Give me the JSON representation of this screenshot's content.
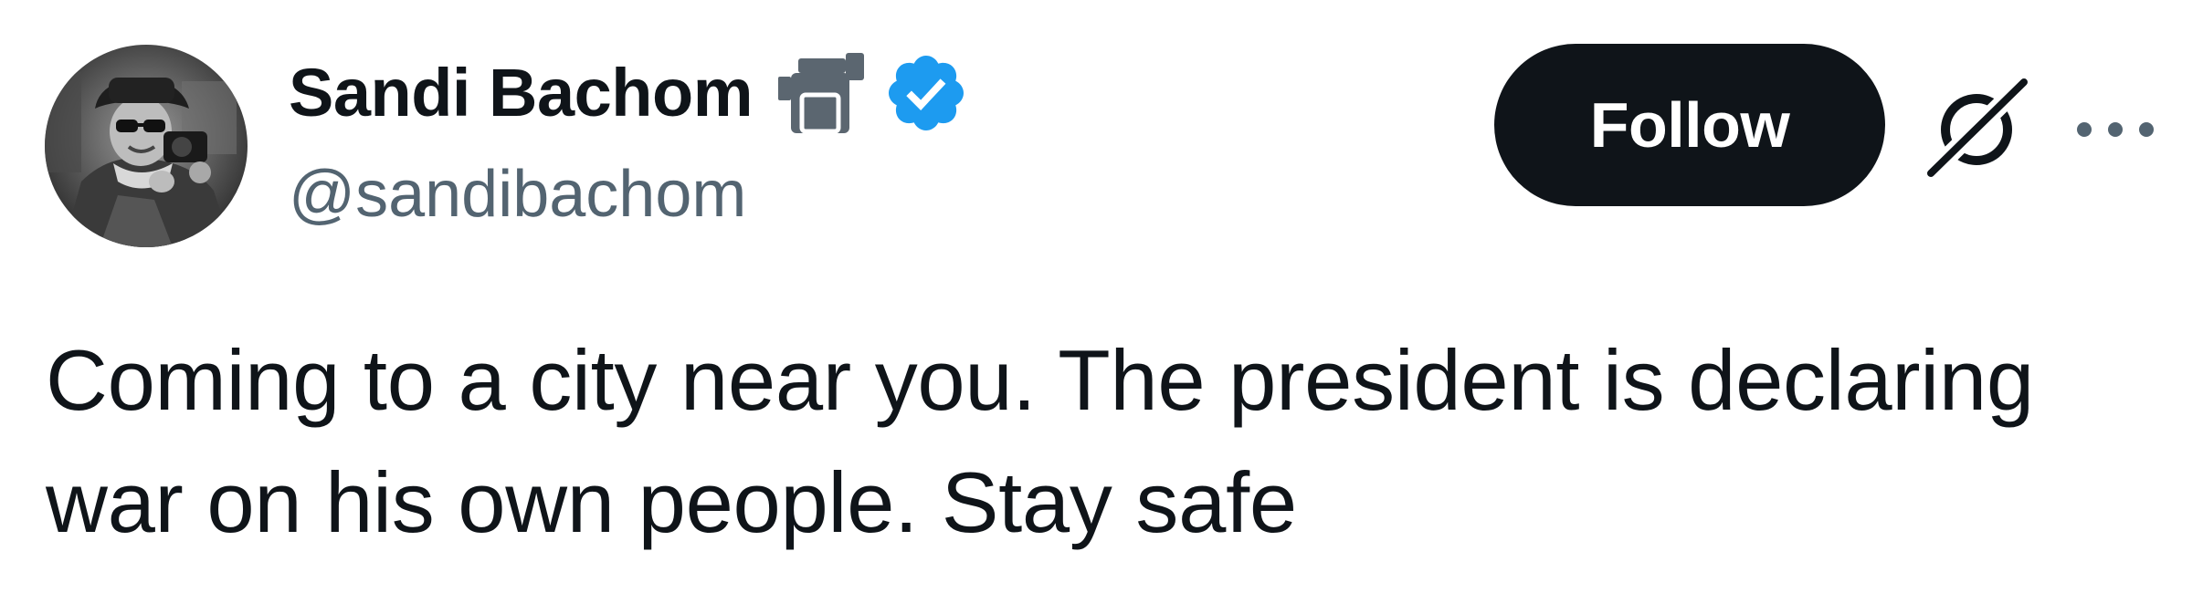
{
  "author": {
    "display_name": "Sandi Bachom",
    "handle": "@sandibachom",
    "avatar_icon": "profile-photo",
    "camera_icon": "video-camera-icon",
    "verified_icon": "verified-badge-icon",
    "verified_color": "#1d9bf0"
  },
  "actions": {
    "follow_label": "Follow",
    "grok_icon": "grok-icon",
    "more_icon": "more-options-icon"
  },
  "tweet": {
    "text": "Coming to a city near you. The president is declaring\nwar on his own people. Stay safe"
  },
  "colors": {
    "text_primary": "#0f1419",
    "text_secondary": "#536471",
    "button_bg": "#0f1419",
    "button_text": "#ffffff",
    "verified": "#1d9bf0"
  }
}
